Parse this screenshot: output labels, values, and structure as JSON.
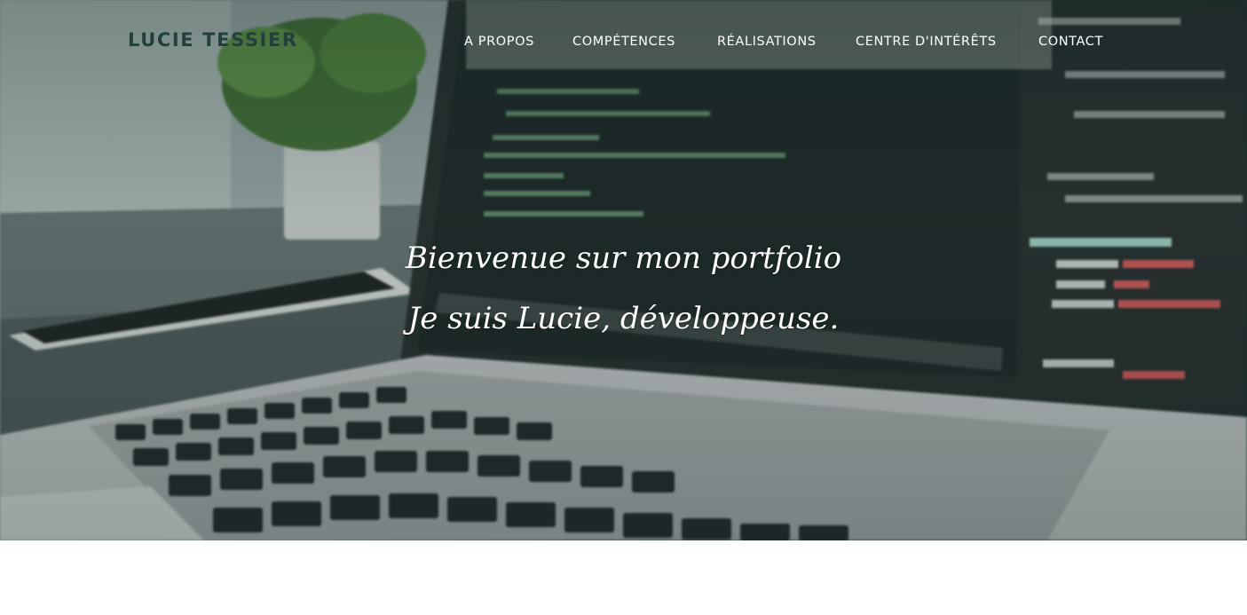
{
  "header": {
    "brand": "LUCIE TESSIER",
    "nav": [
      {
        "label": "A PROPOS"
      },
      {
        "label": "COMPÉTENCES"
      },
      {
        "label": "RÉALISATIONS"
      },
      {
        "label": "CENTRE D'INTÉRÊTS"
      },
      {
        "label": "CONTACT"
      }
    ]
  },
  "hero": {
    "line1": "Bienvenue sur mon portfolio",
    "line2": "Je suis Lucie, développeuse."
  },
  "colors": {
    "brand_text": "#23403d",
    "nav_text": "#ffffff",
    "hero_tint": "#17302d",
    "page_background": "#ffffff"
  }
}
